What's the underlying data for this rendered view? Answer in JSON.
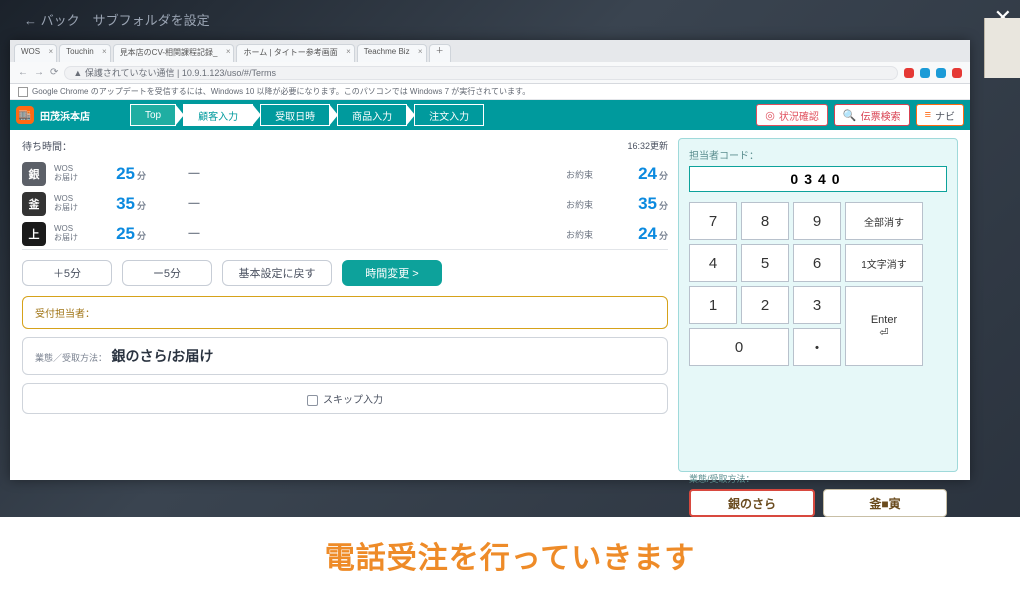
{
  "modal": {
    "back_blur": "← バック　サブフォルダを設定"
  },
  "browser": {
    "tabs": [
      {
        "label": "WOS"
      },
      {
        "label": "Touchin"
      },
      {
        "label": "見本店のCV-相関課程記録_"
      },
      {
        "label": "ホーム | タイトー参考画面"
      },
      {
        "label": "Teachme Biz"
      }
    ],
    "url": "保護されていない通信 | 10.9.1.123/uso/#/Terms",
    "warn": "Google Chrome のアップデートを受信するには、Windows 10 以降が必要になります。このパソコンでは Windows 7 が実行されています。",
    "ext_colors": [
      "#e53935",
      "#1c9bd7",
      "#1c9bd7",
      "#e53935"
    ]
  },
  "header": {
    "store": "田茂浜本店",
    "steps": [
      "Top",
      "顧客入力",
      "受取日時",
      "商品入力",
      "注文入力"
    ],
    "tools": {
      "status": "状況確認",
      "search": "伝票検索",
      "nav": "ナビ"
    }
  },
  "wait": {
    "label": "待ち時間：",
    "updated": "16:32更新",
    "rows": [
      {
        "chip": "銀",
        "line1": "WOS",
        "line2": "お届け",
        "val1": "25",
        "unit": "分",
        "dash": "ー",
        "lbl2": "お約束",
        "val2": "24"
      },
      {
        "chip": "釜",
        "line1": "WOS",
        "line2": "お届け",
        "val1": "35",
        "unit": "分",
        "dash": "ー",
        "lbl2": "お約束",
        "val2": "35"
      },
      {
        "chip": "上",
        "line1": "WOS",
        "line2": "お届け",
        "val1": "25",
        "unit": "分",
        "dash": "ー",
        "lbl2": "お約束",
        "val2": "24"
      }
    ],
    "adjust": {
      "plus": "＋5分",
      "minus": "ー5分",
      "reset": "基本設定に戻す",
      "apply": "時間変更 >"
    }
  },
  "reception": {
    "label": "受付担当者："
  },
  "brand_method": {
    "label": "業態／受取方法：",
    "value": "銀のさら/お届け"
  },
  "skip": {
    "label": "スキップ入力"
  },
  "right": {
    "code_label": "担当者コード：",
    "code_value": "0340",
    "keys": {
      "k7": "7",
      "k8": "8",
      "k9": "9",
      "clear": "全部消す",
      "k4": "4",
      "k5": "5",
      "k6": "6",
      "back": "1文字消す",
      "k1": "1",
      "k2": "2",
      "k3": "3",
      "enter": "Enter",
      "enter_sub": "⏎",
      "k0": "0",
      "dot": "・"
    },
    "method_label": "業態/受取方法：",
    "methods": {
      "a": "銀のさら",
      "b": "釜■寅"
    }
  },
  "caption": "電話受注を行っていきます"
}
